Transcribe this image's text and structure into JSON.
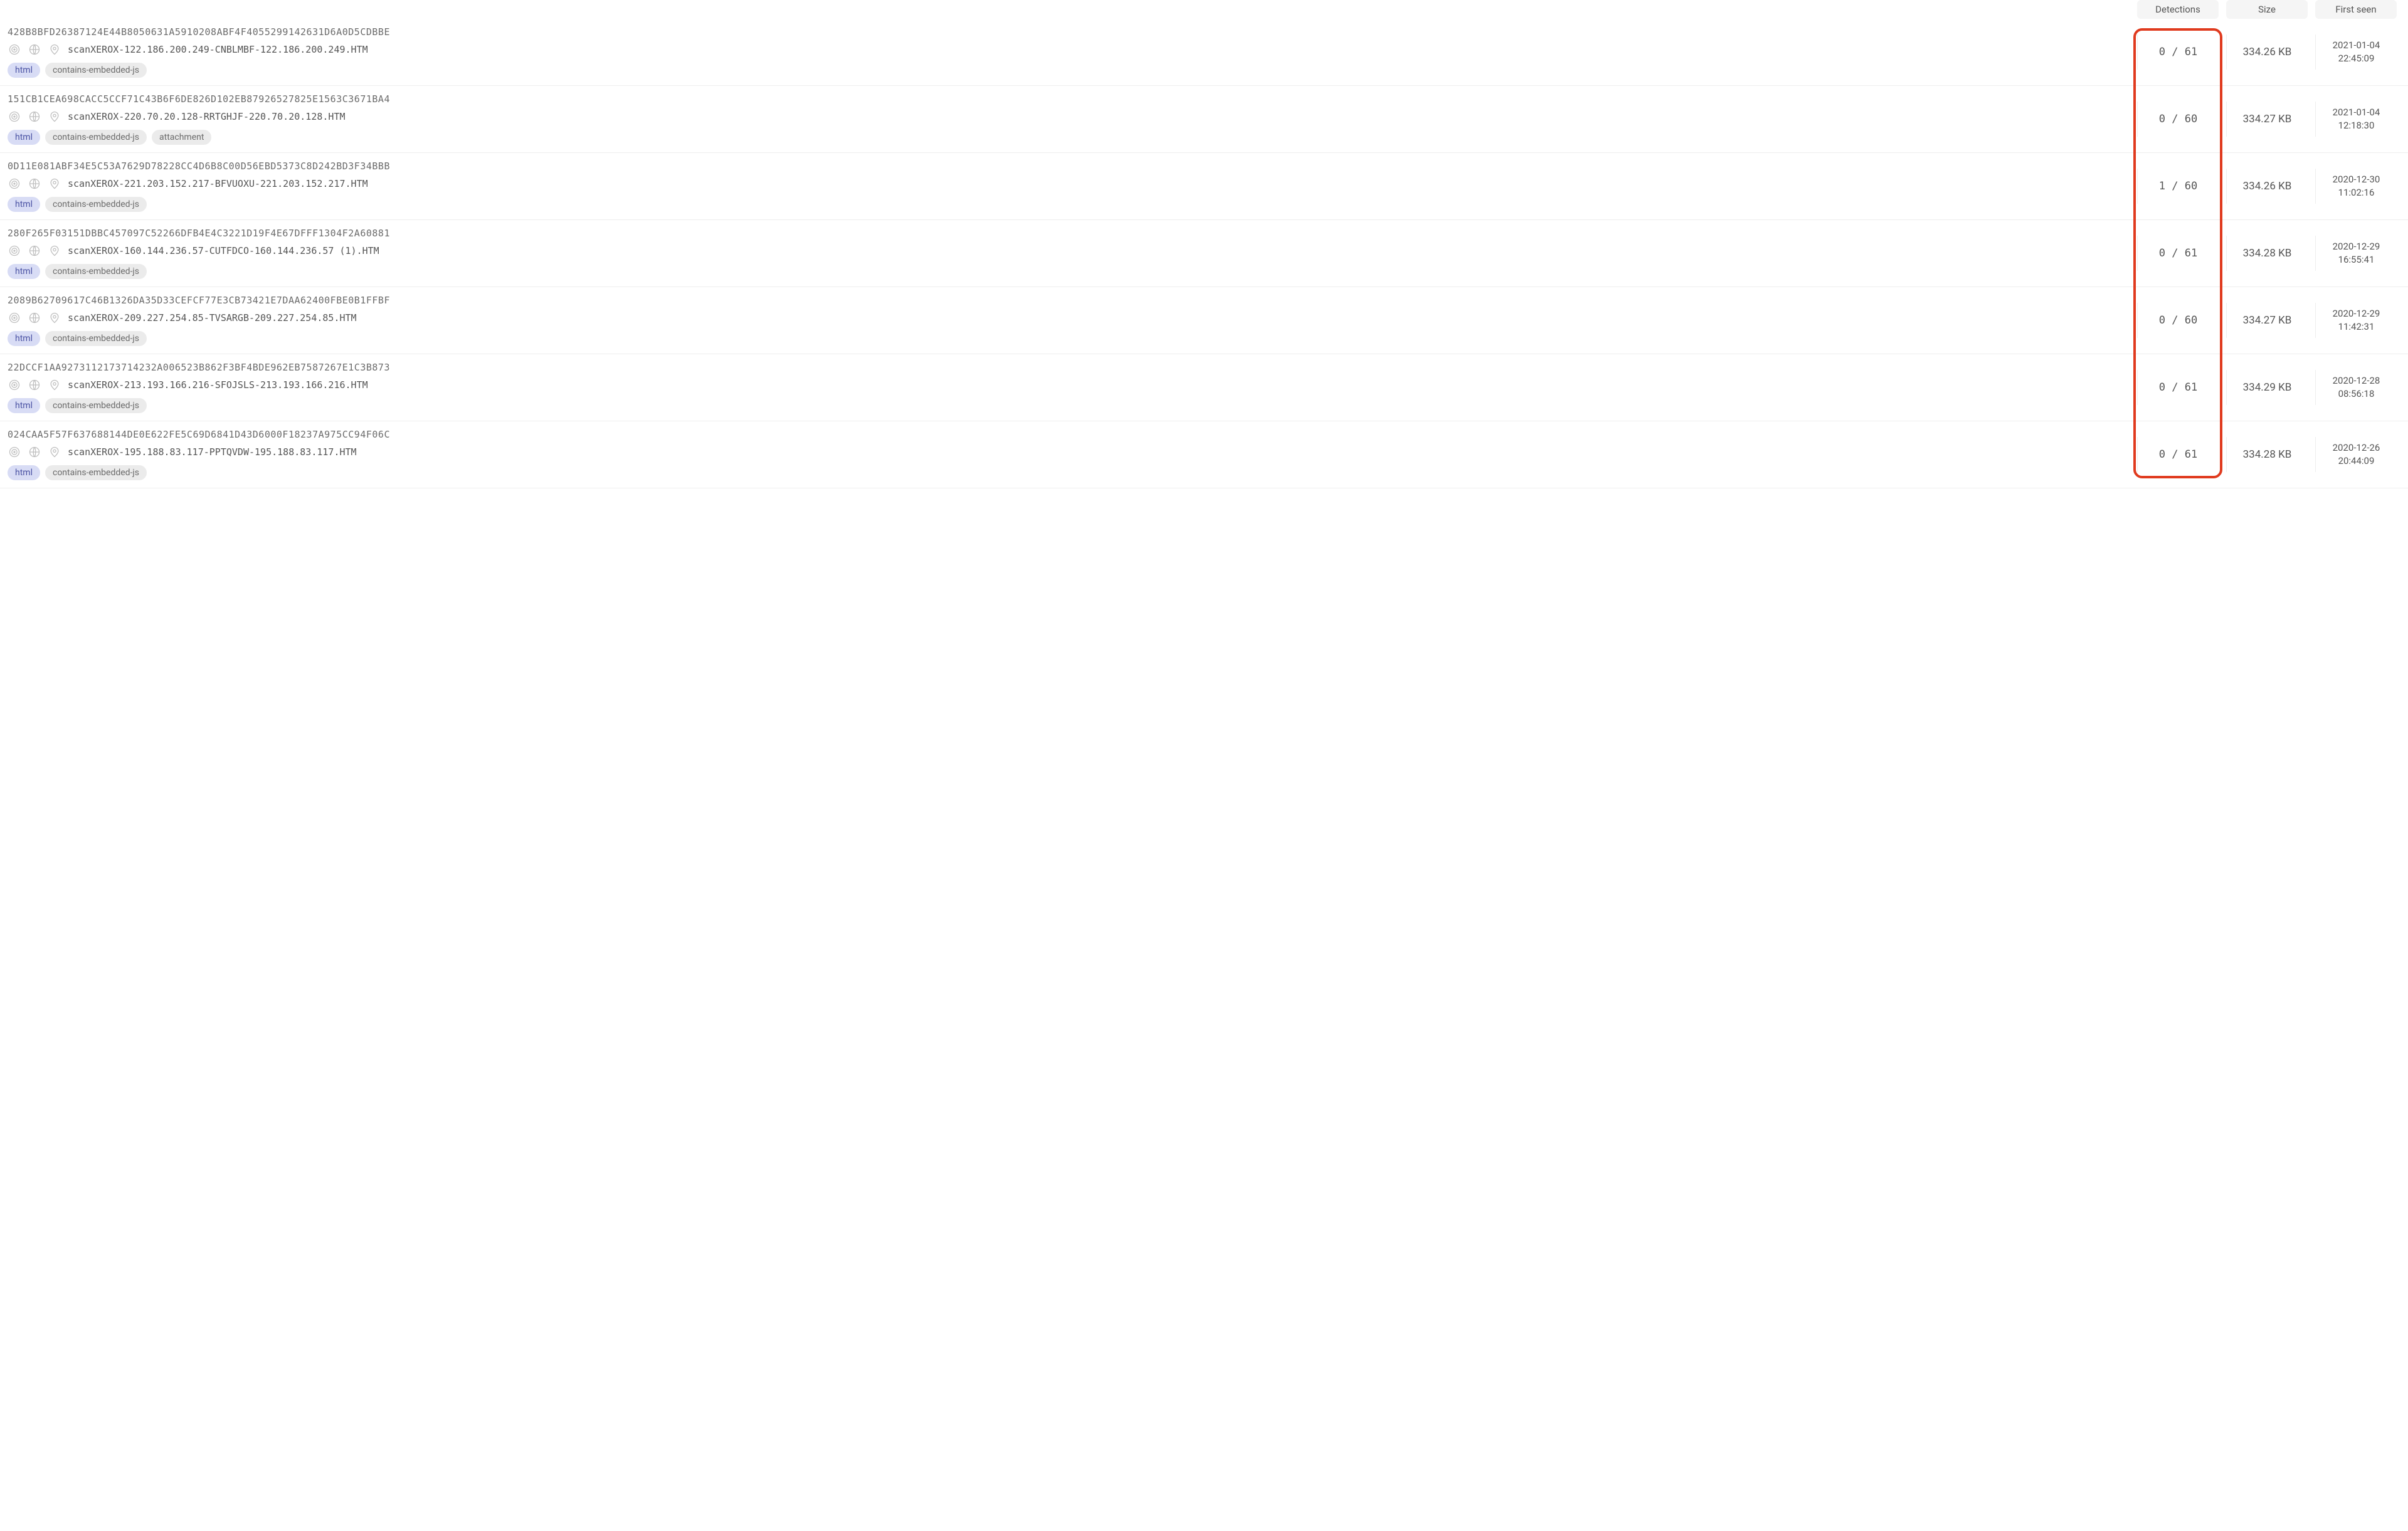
{
  "headers": {
    "detections": "Detections",
    "size": "Size",
    "first_seen": "First seen"
  },
  "tag_labels": {
    "html": "html",
    "js": "contains-embedded-js",
    "attachment": "attachment"
  },
  "rows": [
    {
      "hash": "428B8BFD26387124E44B8050631A5910208ABF4F4055299142631D6A0D5CDBBE",
      "filename": "scanXEROX-122.186.200.249-CNBLMBF-122.186.200.249.HTM",
      "detections": "0 / 61",
      "size": "334.26 KB",
      "date": "2021-01-04",
      "time": "22:45:09",
      "extra_tags": []
    },
    {
      "hash": "151CB1CEA698CACC5CCF71C43B6F6DE826D102EB87926527825E1563C3671BA4",
      "filename": "scanXEROX-220.70.20.128-RRTGHJF-220.70.20.128.HTM",
      "detections": "0 / 60",
      "size": "334.27 KB",
      "date": "2021-01-04",
      "time": "12:18:30",
      "extra_tags": [
        "attachment"
      ]
    },
    {
      "hash": "0D11E081ABF34E5C53A7629D78228CC4D6B8C00D56EBD5373C8D242BD3F34BBB",
      "filename": "scanXEROX-221.203.152.217-BFVUOXU-221.203.152.217.HTM",
      "detections": "1 / 60",
      "size": "334.26 KB",
      "date": "2020-12-30",
      "time": "11:02:16",
      "extra_tags": []
    },
    {
      "hash": "280F265F03151DBBC457097C52266DFB4E4C3221D19F4E67DFFF1304F2A60881",
      "filename": "scanXEROX-160.144.236.57-CUTFDCO-160.144.236.57 (1).HTM",
      "detections": "0 / 61",
      "size": "334.28 KB",
      "date": "2020-12-29",
      "time": "16:55:41",
      "extra_tags": []
    },
    {
      "hash": "2089B62709617C46B1326DA35D33CEFCF77E3CB73421E7DAA62400FBE0B1FFBF",
      "filename": "scanXEROX-209.227.254.85-TVSARGB-209.227.254.85.HTM",
      "detections": "0 / 60",
      "size": "334.27 KB",
      "date": "2020-12-29",
      "time": "11:42:31",
      "extra_tags": []
    },
    {
      "hash": "22DCCF1AA9273112173714232A006523B862F3BF4BDE962EB7587267E1C3B873",
      "filename": "scanXEROX-213.193.166.216-SFOJSLS-213.193.166.216.HTM",
      "detections": "0 / 61",
      "size": "334.29 KB",
      "date": "2020-12-28",
      "time": "08:56:18",
      "extra_tags": []
    },
    {
      "hash": "024CAA5F57F637688144DE0E622FE5C69D6841D43D6000F18237A975CC94F06C",
      "filename": "scanXEROX-195.188.83.117-PPTQVDW-195.188.83.117.HTM",
      "detections": "0 / 61",
      "size": "334.28 KB",
      "date": "2020-12-26",
      "time": "20:44:09",
      "extra_tags": []
    }
  ],
  "annotation": {
    "highlight_column": "detections"
  }
}
